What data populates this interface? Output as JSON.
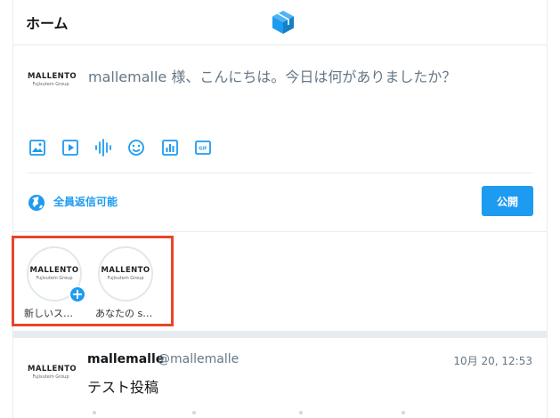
{
  "header": {
    "title": "ホーム",
    "logo_icon": "cube-icon",
    "logo_color": "#1d9bf0"
  },
  "composer": {
    "avatar": {
      "brand": "MALLENTO",
      "sub": "Fujisutem Group"
    },
    "placeholder": "mallemalle 様、こんにちは。今日は何がありましたか？",
    "tools": [
      "image-icon",
      "video-icon",
      "audio-wave-icon",
      "emoji-icon",
      "poll-icon",
      "gif-icon"
    ],
    "reply_setting": {
      "icon": "globe-icon",
      "label": "全員返信可能"
    },
    "publish_label": "公開",
    "accent_color": "#1d9bf0"
  },
  "stories": {
    "highlight_color": "#e8462a",
    "items": [
      {
        "brand": "MALLENTO",
        "sub": "Fujisutem Group",
        "label": "新しいス…",
        "has_add_badge": true
      },
      {
        "brand": "MALLENTO",
        "sub": "Fujisutem Group",
        "label": "あなたの s…",
        "has_add_badge": false
      }
    ]
  },
  "post": {
    "avatar": {
      "brand": "MALLENTO",
      "sub": "Fujisutem Group"
    },
    "display_name": "mallemalle",
    "handle": "@mallemalle",
    "timestamp": "10月 20, 12:53",
    "body": "テスト投稿"
  }
}
